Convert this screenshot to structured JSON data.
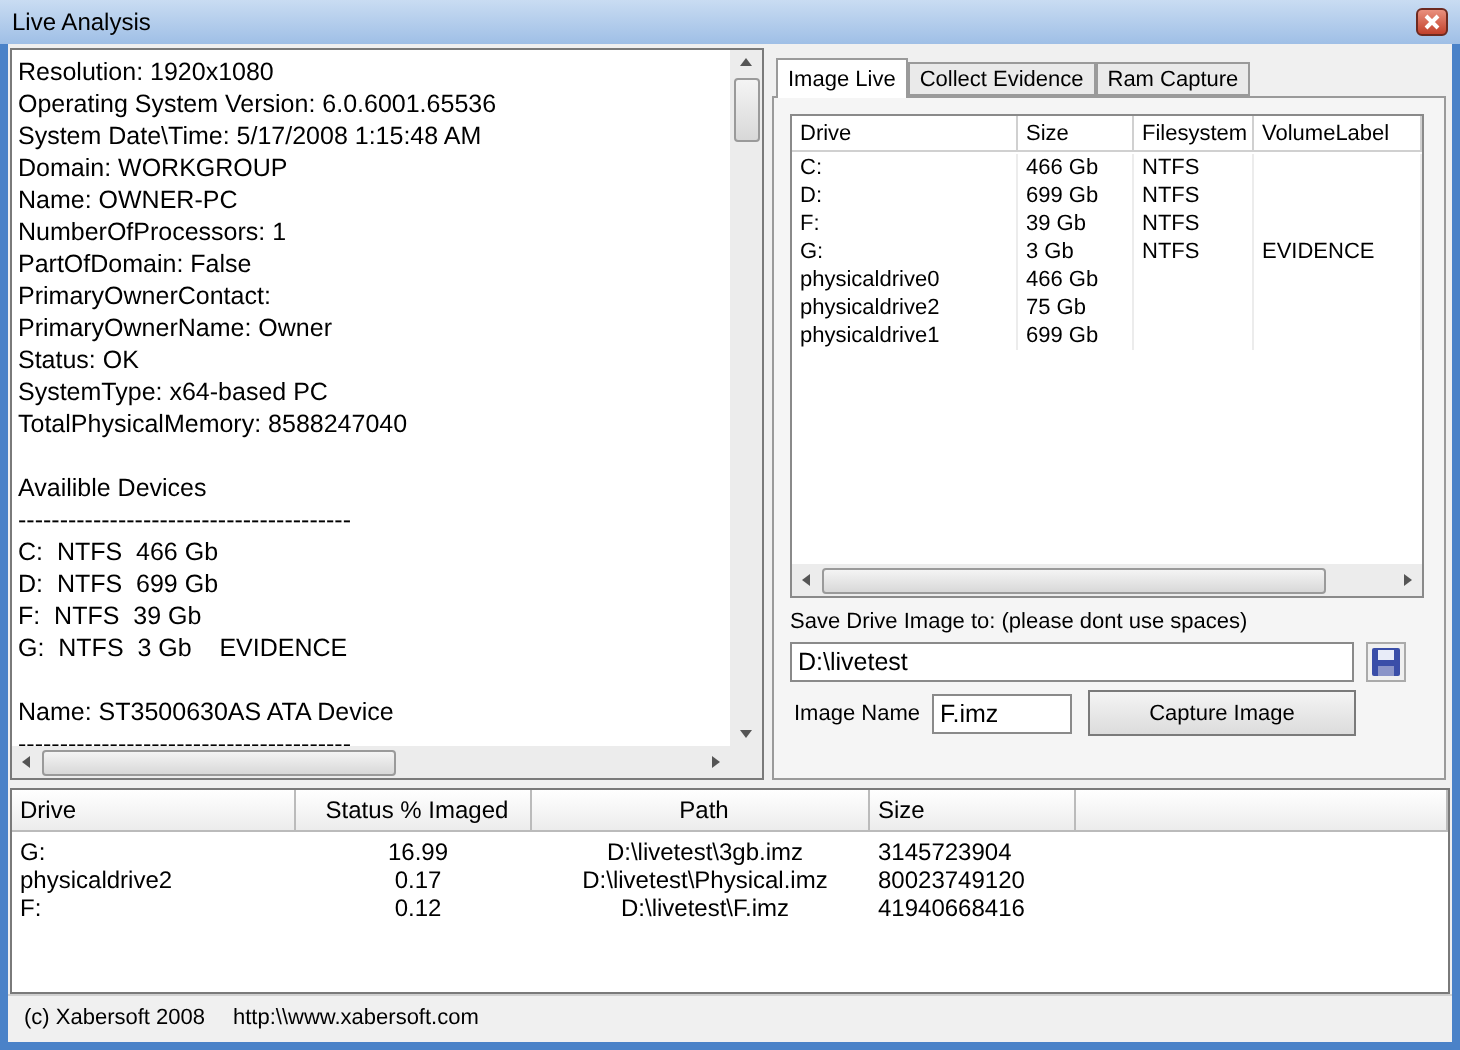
{
  "window": {
    "title": "Live Analysis"
  },
  "log": {
    "groups": [
      [
        "Resolution: 1920x1080",
        "Operating System Version: 6.0.6001.65536",
        "System Date\\Time: 5/17/2008 1:15:48 AM",
        "Domain: WORKGROUP",
        "Name: OWNER-PC",
        "NumberOfProcessors: 1",
        "PartOfDomain: False",
        "PrimaryOwnerContact:",
        "PrimaryOwnerName: Owner",
        "Status: OK",
        "SystemType: x64-based PC",
        "TotalPhysicalMemory: 8588247040"
      ],
      [
        "Availible Devices",
        "----------------------------------------",
        "C:  NTFS  466 Gb",
        "D:  NTFS  699 Gb",
        "F:  NTFS  39 Gb",
        "G:  NTFS  3 Gb    EVIDENCE"
      ],
      [
        "Name: ST3500630AS ATA Device",
        "----------------------------------------"
      ]
    ]
  },
  "tabs": [
    {
      "label": "Image Live",
      "selected": true
    },
    {
      "label": "Collect Evidence",
      "selected": false
    },
    {
      "label": "Ram Capture",
      "selected": false
    }
  ],
  "drives": {
    "columns": [
      "Drive",
      "Size",
      "Filesystem",
      "VolumeLabel"
    ],
    "rows": [
      [
        "C:",
        "466 Gb",
        "NTFS",
        ""
      ],
      [
        "D:",
        "699 Gb",
        "NTFS",
        ""
      ],
      [
        "F:",
        "39 Gb",
        "NTFS",
        ""
      ],
      [
        "G:",
        "3 Gb",
        "NTFS",
        "EVIDENCE"
      ],
      [
        "physicaldrive0",
        "466 Gb",
        "",
        ""
      ],
      [
        "physicaldrive2",
        "75 Gb",
        "",
        ""
      ],
      [
        "physicaldrive1",
        "699 Gb",
        "",
        ""
      ]
    ]
  },
  "save": {
    "label": "Save Drive Image to: (please dont use spaces)",
    "value": "D:\\livetest"
  },
  "image_name": {
    "label": "Image Name",
    "value": "F.imz"
  },
  "capture_button": "Capture Image",
  "progress": {
    "columns": [
      "Drive",
      "Status % Imaged",
      "Path",
      "Size"
    ],
    "rows": [
      [
        "G:",
        "16.99",
        "D:\\livetest\\3gb.imz",
        "3145723904"
      ],
      [
        "physicaldrive2",
        "0.17",
        "D:\\livetest\\Physical.imz",
        "80023749120"
      ],
      [
        "F:",
        "0.12",
        "D:\\livetest\\F.imz",
        "41940668416"
      ]
    ]
  },
  "status_bar": [
    "(c) Xabersoft 2008",
    "http:\\\\www.xabersoft.com"
  ]
}
